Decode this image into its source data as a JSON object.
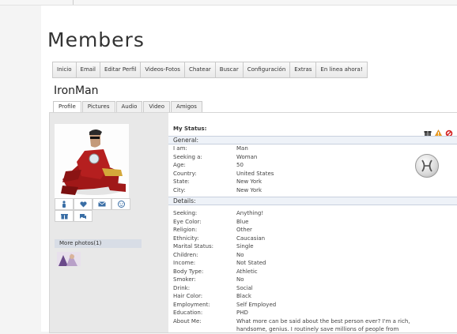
{
  "page_title": "Members",
  "nav": [
    "Inicio",
    "Email",
    "Editar Perfil",
    "Videos-Fotos",
    "Chatear",
    "Buscar",
    "Configuración",
    "Extras",
    "En linea ahora!"
  ],
  "profile": {
    "username": "IronMan",
    "tabs": [
      "Profile",
      "Pictures",
      "Audio",
      "Video",
      "Amigos"
    ],
    "active_tab": "Profile",
    "more_photos_label": "More photos(1)",
    "my_status_label": "My Status:",
    "general_label": "General:",
    "details_label": "Details:",
    "general": [
      {
        "k": "I am:",
        "v": "Man"
      },
      {
        "k": "Seeking a:",
        "v": "Woman"
      },
      {
        "k": "Age:",
        "v": "50"
      },
      {
        "k": "Country:",
        "v": "United States"
      },
      {
        "k": "State:",
        "v": "New York"
      },
      {
        "k": "City:",
        "v": "New York"
      }
    ],
    "details": [
      {
        "k": "Seeking:",
        "v": "Anything!"
      },
      {
        "k": "Eye Color:",
        "v": "Blue"
      },
      {
        "k": "Religion:",
        "v": "Other"
      },
      {
        "k": "Ethnicity:",
        "v": "Caucasian"
      },
      {
        "k": "Marital Status:",
        "v": "Single"
      },
      {
        "k": "Children:",
        "v": "No"
      },
      {
        "k": "Income:",
        "v": "Not Stated"
      },
      {
        "k": "Body Type:",
        "v": "Athletic"
      },
      {
        "k": "Smoker:",
        "v": "No"
      },
      {
        "k": "Drink:",
        "v": "Social"
      },
      {
        "k": "Hair Color:",
        "v": "Black"
      },
      {
        "k": "Employment:",
        "v": "Self Employed"
      },
      {
        "k": "Education:",
        "v": "PHD"
      },
      {
        "k": "About Me:",
        "v": "What more can be said about the best person ever? I'm a rich, handsome, genius. I routinely save millions of people from"
      }
    ],
    "action_icons": [
      "person-icon",
      "heart-icon",
      "mail-icon",
      "smiley-icon",
      "gift-icon",
      "chat-icon"
    ],
    "status_icons": [
      "gift-box-icon",
      "warning-icon",
      "block-icon"
    ],
    "zodiac": "pisces-icon"
  },
  "colors": {
    "accent": "#3a6ea5",
    "section_bg": "#eef2f8"
  }
}
